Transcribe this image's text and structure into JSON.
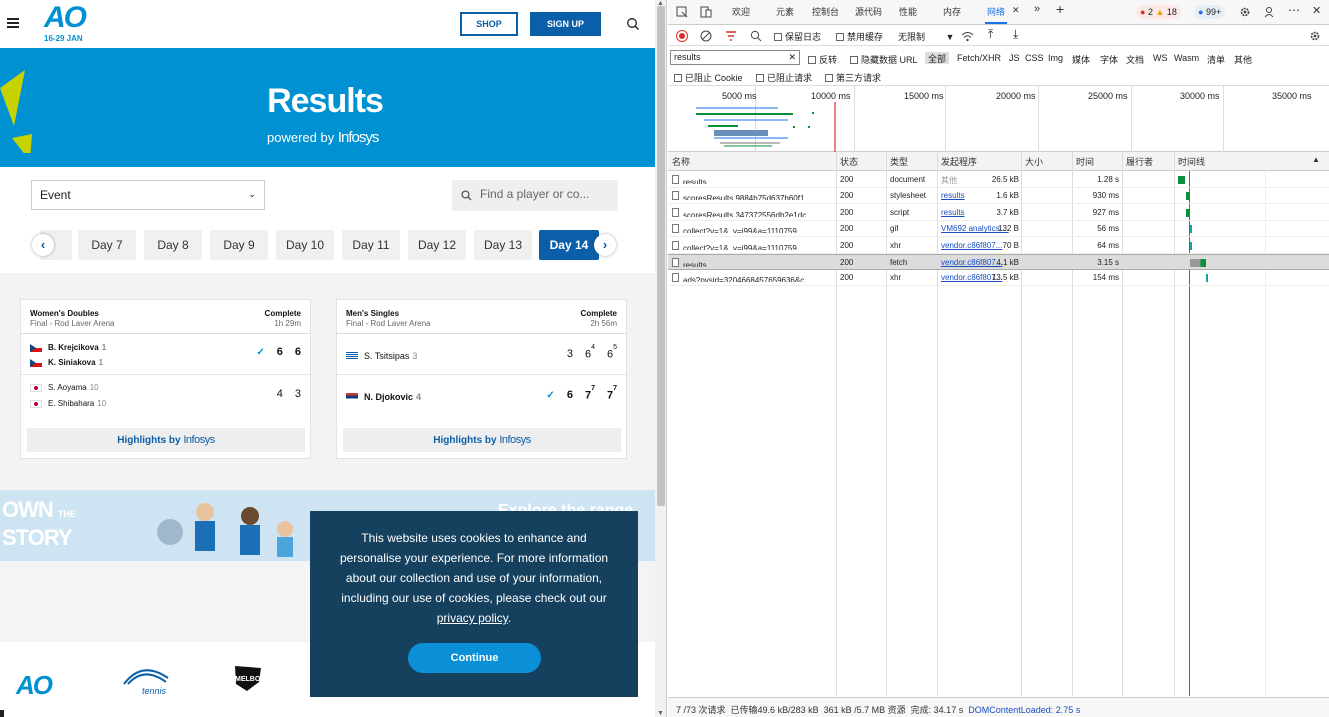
{
  "site": {
    "logo_text": "AO",
    "dates": "16-29 JAN",
    "shop_label": "SHOP",
    "signup_label": "SIGN UP",
    "hero_title": "Results",
    "powered_by": "powered by",
    "infosys": "Infosys",
    "event_select": "Event",
    "search_placeholder": "Find a player or co...",
    "day_tabs": [
      "Day 7",
      "Day 8",
      "Day 9",
      "Day 10",
      "Day 11",
      "Day 12",
      "Day 13",
      "Day 14"
    ],
    "active_day": "Day 14",
    "cards": [
      {
        "event": "Women's Doubles",
        "round": "Final - Rod Laver Arena",
        "status": "Complete",
        "duration": "1h 29m",
        "teams": [
          {
            "players": [
              {
                "name": "B. Krejcikova",
                "seed": "1",
                "flag": "cz"
              },
              {
                "name": "K. Siniakova",
                "seed": "1",
                "flag": "cz"
              }
            ],
            "winner": true,
            "scores": [
              "6",
              "6"
            ],
            "tiebreaks": [
              "",
              ""
            ]
          },
          {
            "players": [
              {
                "name": "S. Aoyama",
                "seed": "10",
                "flag": "jp"
              },
              {
                "name": "E. Shibahara",
                "seed": "10",
                "flag": "jp"
              }
            ],
            "winner": false,
            "scores": [
              "4",
              "3"
            ],
            "tiebreaks": [
              "",
              ""
            ]
          }
        ],
        "highlights": "Highlights by"
      },
      {
        "event": "Men's Singles",
        "round": "Final - Rod Laver Arena",
        "status": "Complete",
        "duration": "2h 56m",
        "teams": [
          {
            "players": [
              {
                "name": "S. Tsitsipas",
                "seed": "3",
                "flag": "gr"
              }
            ],
            "winner": false,
            "scores": [
              "3",
              "6",
              "6"
            ],
            "tiebreaks": [
              "",
              "4",
              "5"
            ]
          },
          {
            "players": [
              {
                "name": "N. Djokovic",
                "seed": "4",
                "flag": "rs"
              }
            ],
            "winner": true,
            "scores": [
              "6",
              "7",
              "7"
            ],
            "tiebreaks": [
              "",
              "7",
              "7"
            ]
          }
        ],
        "highlights": "Highlights by"
      }
    ],
    "banner": {
      "own": "OWN",
      "the": "THE",
      "story": "STORY",
      "explore": "Explore the range"
    },
    "cookie": {
      "text": "This website uses cookies to enhance and personalise your experience. For more information about our collection and use of your information, including our use of cookies, please check out our",
      "link": "privacy policy",
      "period": ".",
      "button": "Continue"
    },
    "footer": {
      "ao": "AO",
      "tennis": "tennis",
      "melbourne": "MELBOURNE"
    }
  },
  "devtools": {
    "tabs": [
      "欢迎",
      "元素",
      "控制台",
      "源代码",
      "性能",
      "内存",
      "网络"
    ],
    "active_tab": "网络",
    "errors": "2",
    "warnings": "18",
    "messages": "99+",
    "controls": {
      "preserve_log": "保留日志",
      "disable_cache": "禁用缓存",
      "throttle": "无限制"
    },
    "filter_value": "results",
    "filter_options": {
      "invert": "反转",
      "hide_data_urls": "隐藏数据 URL",
      "all": "全部"
    },
    "types": [
      "Fetch/XHR",
      "JS",
      "CSS",
      "Img",
      "媒体",
      "字体",
      "文档",
      "WS",
      "Wasm",
      "清单",
      "其他"
    ],
    "blocked_cookies": "已阻止 Cookie",
    "blocked_requests": "已阻止请求",
    "third_party": "第三方请求",
    "overview_ticks": [
      "5000 ms",
      "10000 ms",
      "15000 ms",
      "20000 ms",
      "25000 ms",
      "30000 ms",
      "35000 ms"
    ],
    "columns": [
      "名称",
      "状态",
      "类型",
      "发起程序",
      "大小",
      "时间",
      "履行者",
      "时间线"
    ],
    "rows": [
      {
        "name": "results",
        "status": "200",
        "type": "document",
        "initiator": "其他",
        "initiator_link": false,
        "size": "26.5 kB",
        "time": "1.28 s"
      },
      {
        "name": "scoresResults.9884b75d637b60f1...",
        "status": "200",
        "type": "stylesheet",
        "initiator": "results",
        "initiator_link": true,
        "size": "1.6 kB",
        "time": "930 ms"
      },
      {
        "name": "scoresResults.347372556db2e1dc...",
        "status": "200",
        "type": "script",
        "initiator": "results",
        "initiator_link": true,
        "size": "3.7 kB",
        "time": "927 ms"
      },
      {
        "name": "collect?v=1&_v=j99&a=1110759...",
        "status": "200",
        "type": "gif",
        "initiator": "VM692 analytics....",
        "initiator_link": true,
        "size": "132 B",
        "time": "56 ms"
      },
      {
        "name": "collect?v=1&_v=j99&a=1110759...",
        "status": "200",
        "type": "xhr",
        "initiator": "vendor.c86f807...",
        "initiator_link": true,
        "size": "70 B",
        "time": "64 ms"
      },
      {
        "name": "results",
        "status": "200",
        "type": "fetch",
        "initiator": "vendor.c86f807...",
        "initiator_link": true,
        "size": "4.1 kB",
        "time": "3.15 s",
        "selected": true
      },
      {
        "name": "ads?pvsid=3204668457659636&c...",
        "status": "200",
        "type": "xhr",
        "initiator": "vendor.c86f807...",
        "initiator_link": true,
        "size": "13.5 kB",
        "time": "154 ms"
      }
    ],
    "status_bar": {
      "requests": "7 /73 次请求",
      "transferred": "已传输49.6 kB/283 kB",
      "resources": "361 kB /5.7 MB 资源",
      "finish": "完成: 34.17 s",
      "dcl_label": "DOMContentLoaded:",
      "dcl_value": "2.75 s"
    }
  }
}
